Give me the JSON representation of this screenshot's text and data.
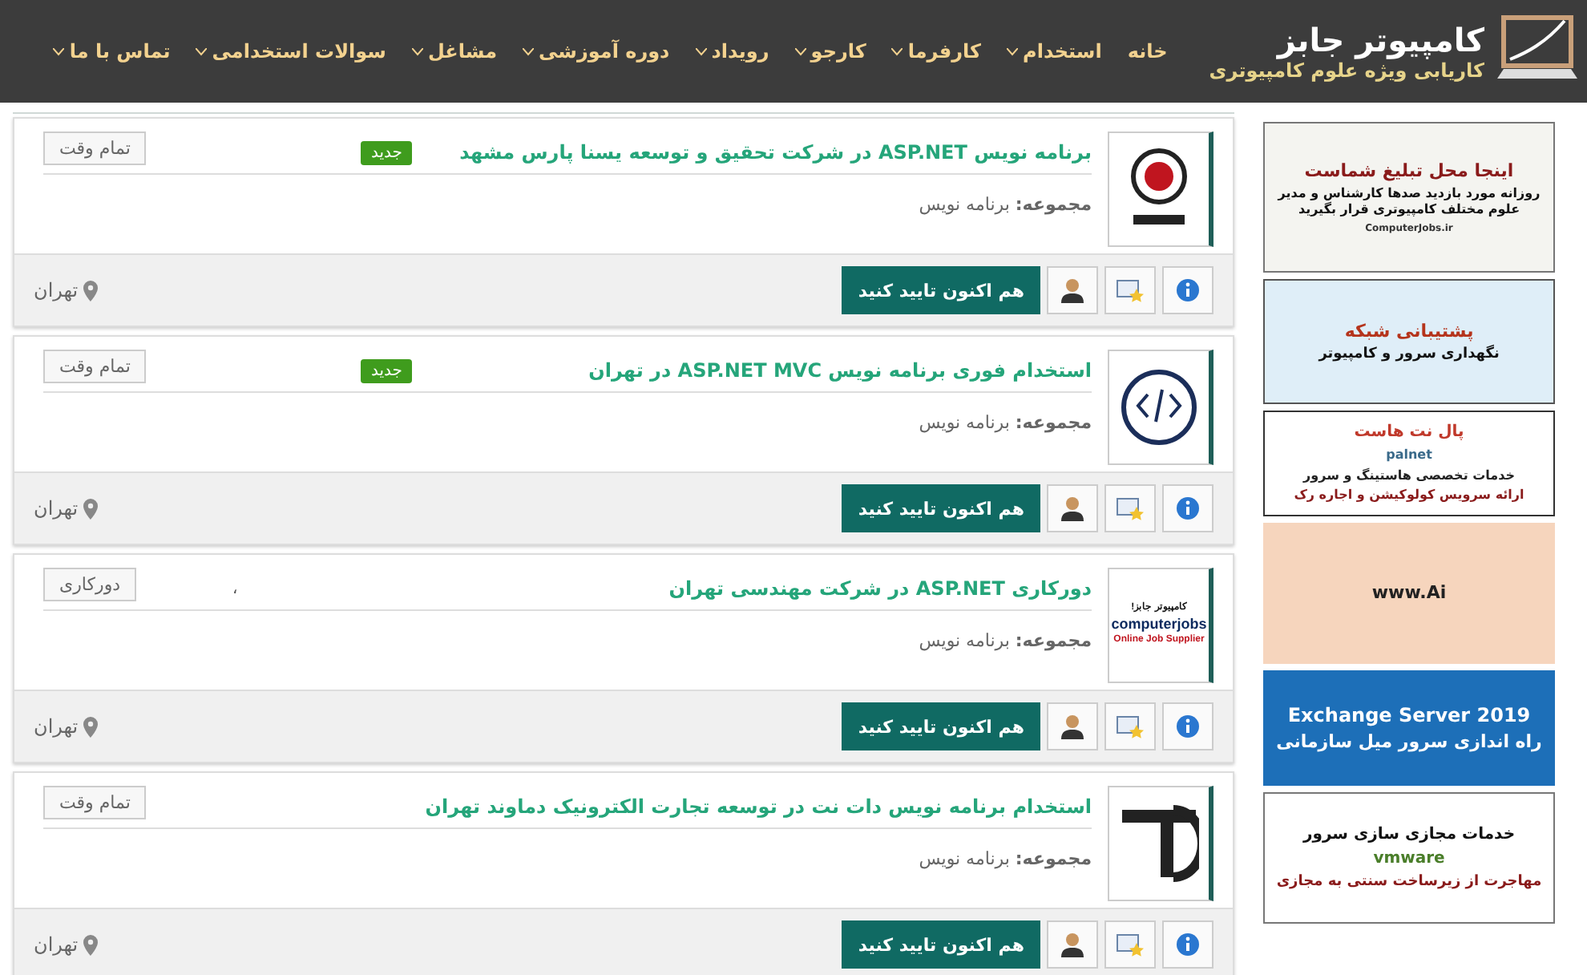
{
  "header": {
    "logo": {
      "title": "کامپیوتر جابز",
      "subtitle": "کاریابی ویژه علوم کامپیوتری"
    },
    "nav": [
      {
        "label": "خانه",
        "has_menu": false
      },
      {
        "label": "استخدام",
        "has_menu": true
      },
      {
        "label": "کارفرما",
        "has_menu": true
      },
      {
        "label": "کارجو",
        "has_menu": true
      },
      {
        "label": "رویداد",
        "has_menu": true
      },
      {
        "label": "دوره آموزشی",
        "has_menu": true
      },
      {
        "label": "مشاغل",
        "has_menu": true
      },
      {
        "label": "سوالات استخدامی",
        "has_menu": true
      },
      {
        "label": "تماس با ما",
        "has_menu": true
      }
    ]
  },
  "jobs": [
    {
      "title": "برنامه نویس ASP.NET در شرکت تحقیق و توسعه یسنا پارس مشهد",
      "is_new": true,
      "new_label": "جدید",
      "job_type": "تمام وقت",
      "category_label": "مجموعه:",
      "category": "برنامه نویس",
      "location": "تهران",
      "apply_label": "هم اکنون تایید کنید",
      "logo": {
        "kind": "circle"
      }
    },
    {
      "title": "استخدام فوری برنامه نویس ASP.NET MVC در تهران",
      "is_new": true,
      "new_label": "جدید",
      "job_type": "تمام وقت",
      "category_label": "مجموعه:",
      "category": "برنامه نویس",
      "location": "تهران",
      "apply_label": "هم اکنون تایید کنید",
      "logo": {
        "kind": "code"
      }
    },
    {
      "title": "دورکاری ASP.NET در شرکت مهندسی تهران",
      "is_new": false,
      "job_type": "دورکاری",
      "mark": "،",
      "category_label": "مجموعه:",
      "category": "برنامه نویس",
      "location": "تهران",
      "apply_label": "هم اکنون تایید کنید",
      "logo": {
        "kind": "text",
        "lines": [
          "کامپیوتر جابز!",
          "computerjobs",
          "Online Job Supplier"
        ]
      }
    },
    {
      "title": "استخدام برنامه نویس دات نت در توسعه تجارت الکترونیک دماوند تهران",
      "is_new": false,
      "job_type": "تمام وقت",
      "category_label": "مجموعه:",
      "category": "برنامه نویس",
      "location": "تهران",
      "apply_label": "هم اکنون تایید کنید",
      "logo": {
        "kind": "letter"
      }
    }
  ],
  "ads": [
    {
      "kind": "billboard",
      "lines": [
        "اینجا محل تبلیغ شماست",
        "روزانه مورد بازدید صدها کارشناس و مدیر علوم مختلف کامپیوتری قرار بگیرید",
        "ComputerJobs.ir"
      ]
    },
    {
      "kind": "network",
      "lines": [
        "پشتیبانی شبکه",
        "نگهداری سرور و کامپیوتر"
      ]
    },
    {
      "kind": "hosting",
      "lines": [
        "پال نت هاست",
        "palnet",
        "خدمات تخصصی هاستینگ و سرور",
        "ارائه سرویس کولوکیشن و اجاره رک"
      ]
    },
    {
      "kind": "laptop",
      "lines": [
        "www.Ai"
      ]
    },
    {
      "kind": "exchange",
      "lines": [
        "Exchange Server 2019",
        "راه اندازی سرور میل سازمانی"
      ]
    },
    {
      "kind": "virtual",
      "lines": [
        "خدمات مجازی سازی سرور",
        "vmware",
        "مهاجرت از زیرساخت سنتی به مجازی"
      ]
    }
  ]
}
